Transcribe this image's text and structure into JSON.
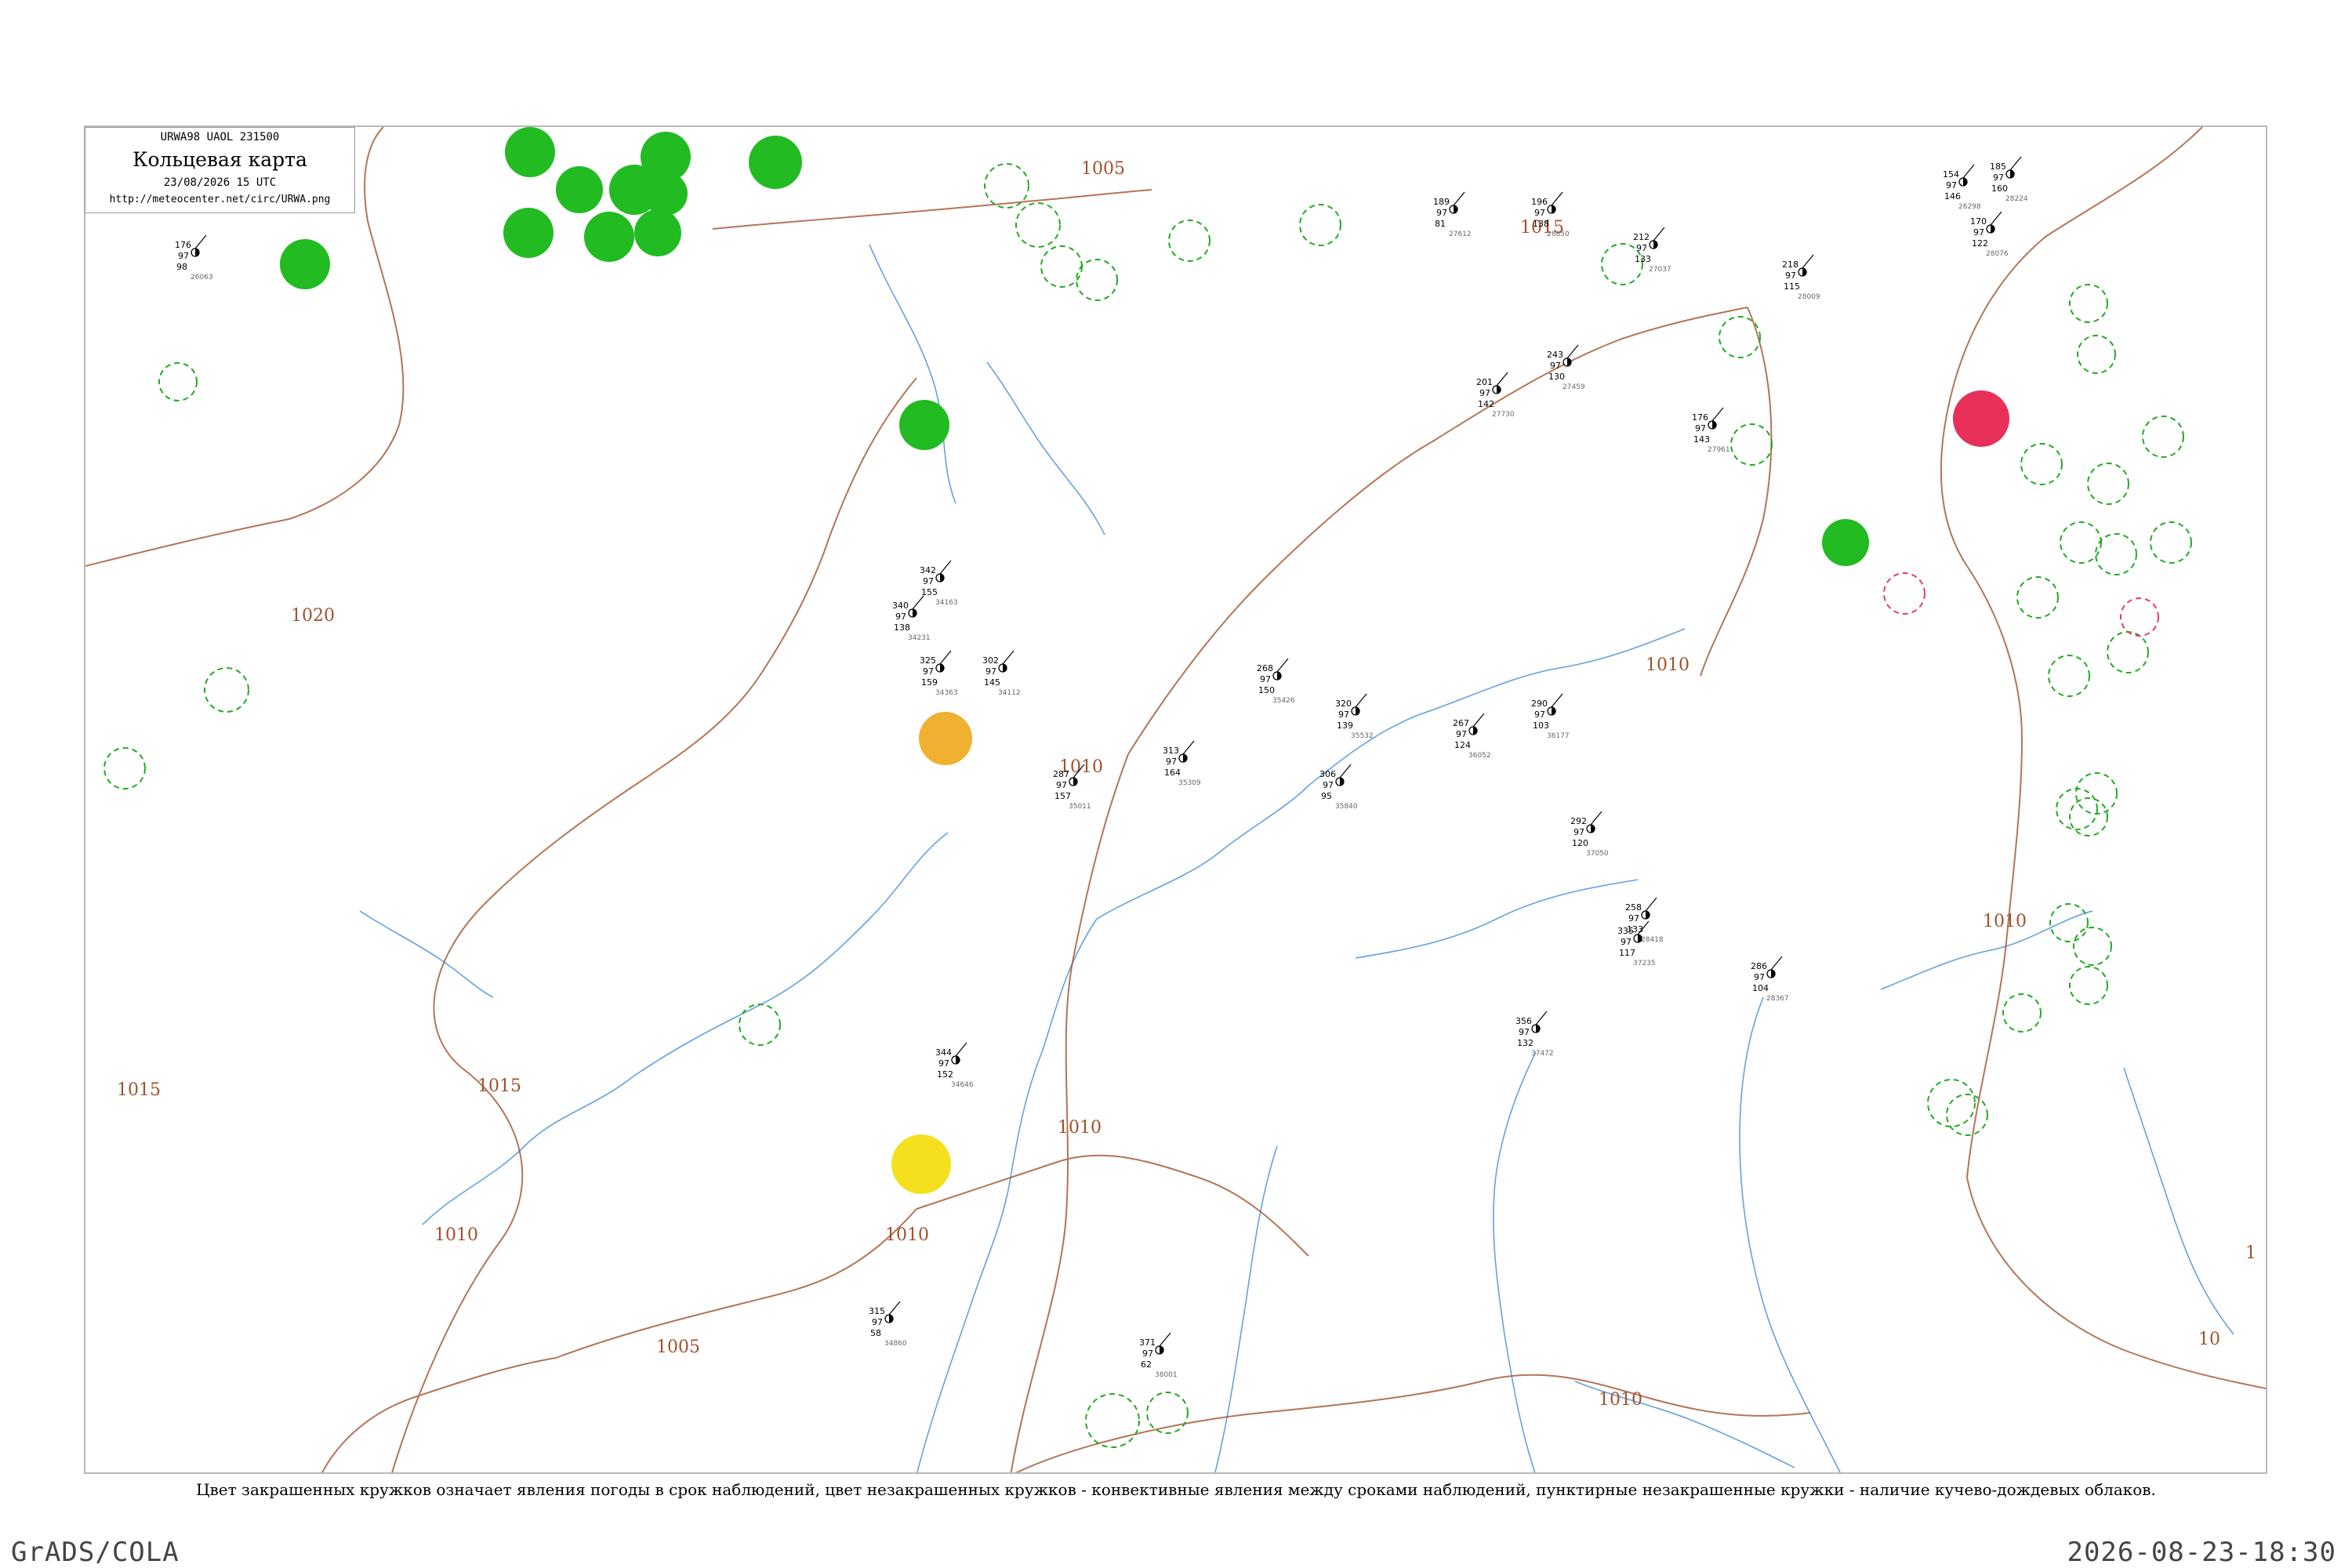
{
  "header": {
    "code": "URWA98  UAOL  231500",
    "title": "Кольцевая карта",
    "time": "23/08/2026 15 UTC",
    "url": "http://meteocenter.net/circ/URWA.png"
  },
  "caption": "Цвет закрашенных кружков означает явления погоды в срок наблюдений, цвет незакрашенных кружков - конвективные явления между сроками наблюдений, пунктирные незакрашенные кружки - наличие кучево-дождевых облаков.",
  "footer": {
    "left": "GrADS/COLA",
    "right": "2026-08-23-18:30"
  },
  "colors": {
    "isobar": "#a0522d",
    "river": "#4a90d9",
    "rain_fill": "#22bb22",
    "thunder_fill": "#e8305a",
    "fog_fill": "#f0b030",
    "haze_fill": "#f5e020",
    "cb_dashed": "#22aa22",
    "cb_dashed_red": "#e04060"
  },
  "isobar_labels": [
    "1005",
    "1015",
    "1020",
    "1010",
    "1010",
    "1015",
    "1010",
    "1005",
    "1010",
    "1010",
    "1010",
    "1015",
    "1010",
    "10",
    "1"
  ],
  "stations": [
    {
      "t": "185",
      "p": "97",
      "d": "160",
      "id": "28224"
    },
    {
      "t": "176",
      "p": "97",
      "d": "98",
      "id": "26063"
    },
    {
      "t": "154",
      "p": "97",
      "d": "146",
      "id": "26298"
    },
    {
      "t": "189",
      "p": "97",
      "d": "81",
      "id": "27612"
    },
    {
      "t": "196",
      "p": "97",
      "d": "138",
      "id": "26850"
    },
    {
      "t": "212",
      "p": "97",
      "d": "133",
      "id": "27037"
    },
    {
      "t": "243",
      "p": "97",
      "d": "130",
      "id": "27459"
    },
    {
      "t": "201",
      "p": "97",
      "d": "142",
      "id": "27730"
    },
    {
      "t": "218",
      "p": "97",
      "d": "115",
      "id": "28009"
    },
    {
      "t": "176",
      "p": "97",
      "d": "143",
      "id": "27961"
    },
    {
      "t": "170",
      "p": "97",
      "d": "122",
      "id": "28076"
    },
    {
      "t": "342",
      "p": "97",
      "d": "155",
      "id": "34163"
    },
    {
      "t": "340",
      "p": "97",
      "d": "138",
      "id": "34231"
    },
    {
      "t": "325",
      "p": "97",
      "d": "159",
      "id": "34363"
    },
    {
      "t": "302",
      "p": "97",
      "d": "145",
      "id": "34112"
    },
    {
      "t": "287",
      "p": "97",
      "d": "157",
      "id": "35011"
    },
    {
      "t": "313",
      "p": "97",
      "d": "164",
      "id": "35309"
    },
    {
      "t": "268",
      "p": "97",
      "d": "150",
      "id": "35426"
    },
    {
      "t": "320",
      "p": "97",
      "d": "139",
      "id": "35532"
    },
    {
      "t": "306",
      "p": "97",
      "d": "95",
      "id": "35840"
    },
    {
      "t": "267",
      "p": "97",
      "d": "124",
      "id": "36052"
    },
    {
      "t": "290",
      "p": "97",
      "d": "103",
      "id": "36177"
    },
    {
      "t": "292",
      "p": "97",
      "d": "120",
      "id": "37050"
    },
    {
      "t": "335",
      "p": "97",
      "d": "117",
      "id": "37235"
    },
    {
      "t": "356",
      "p": "97",
      "d": "132",
      "id": "37472"
    },
    {
      "t": "286",
      "p": "97",
      "d": "104",
      "id": "28367"
    },
    {
      "t": "258",
      "p": "97",
      "d": "133",
      "id": "28418"
    },
    {
      "t": "344",
      "p": "97",
      "d": "152",
      "id": "34646"
    },
    {
      "t": "371",
      "p": "97",
      "d": "62",
      "id": "38001"
    },
    {
      "t": "315",
      "p": "97",
      "d": "58",
      "id": "34860"
    }
  ],
  "weather_markers": [
    {
      "kind": "rain"
    },
    {
      "kind": "rain"
    },
    {
      "kind": "rain"
    },
    {
      "kind": "rain"
    },
    {
      "kind": "rain"
    },
    {
      "kind": "rain"
    },
    {
      "kind": "rain"
    },
    {
      "kind": "rain"
    },
    {
      "kind": "rain"
    },
    {
      "kind": "rain"
    },
    {
      "kind": "rain"
    },
    {
      "kind": "rain"
    },
    {
      "kind": "thunder"
    },
    {
      "kind": "fog"
    },
    {
      "kind": "haze"
    }
  ]
}
